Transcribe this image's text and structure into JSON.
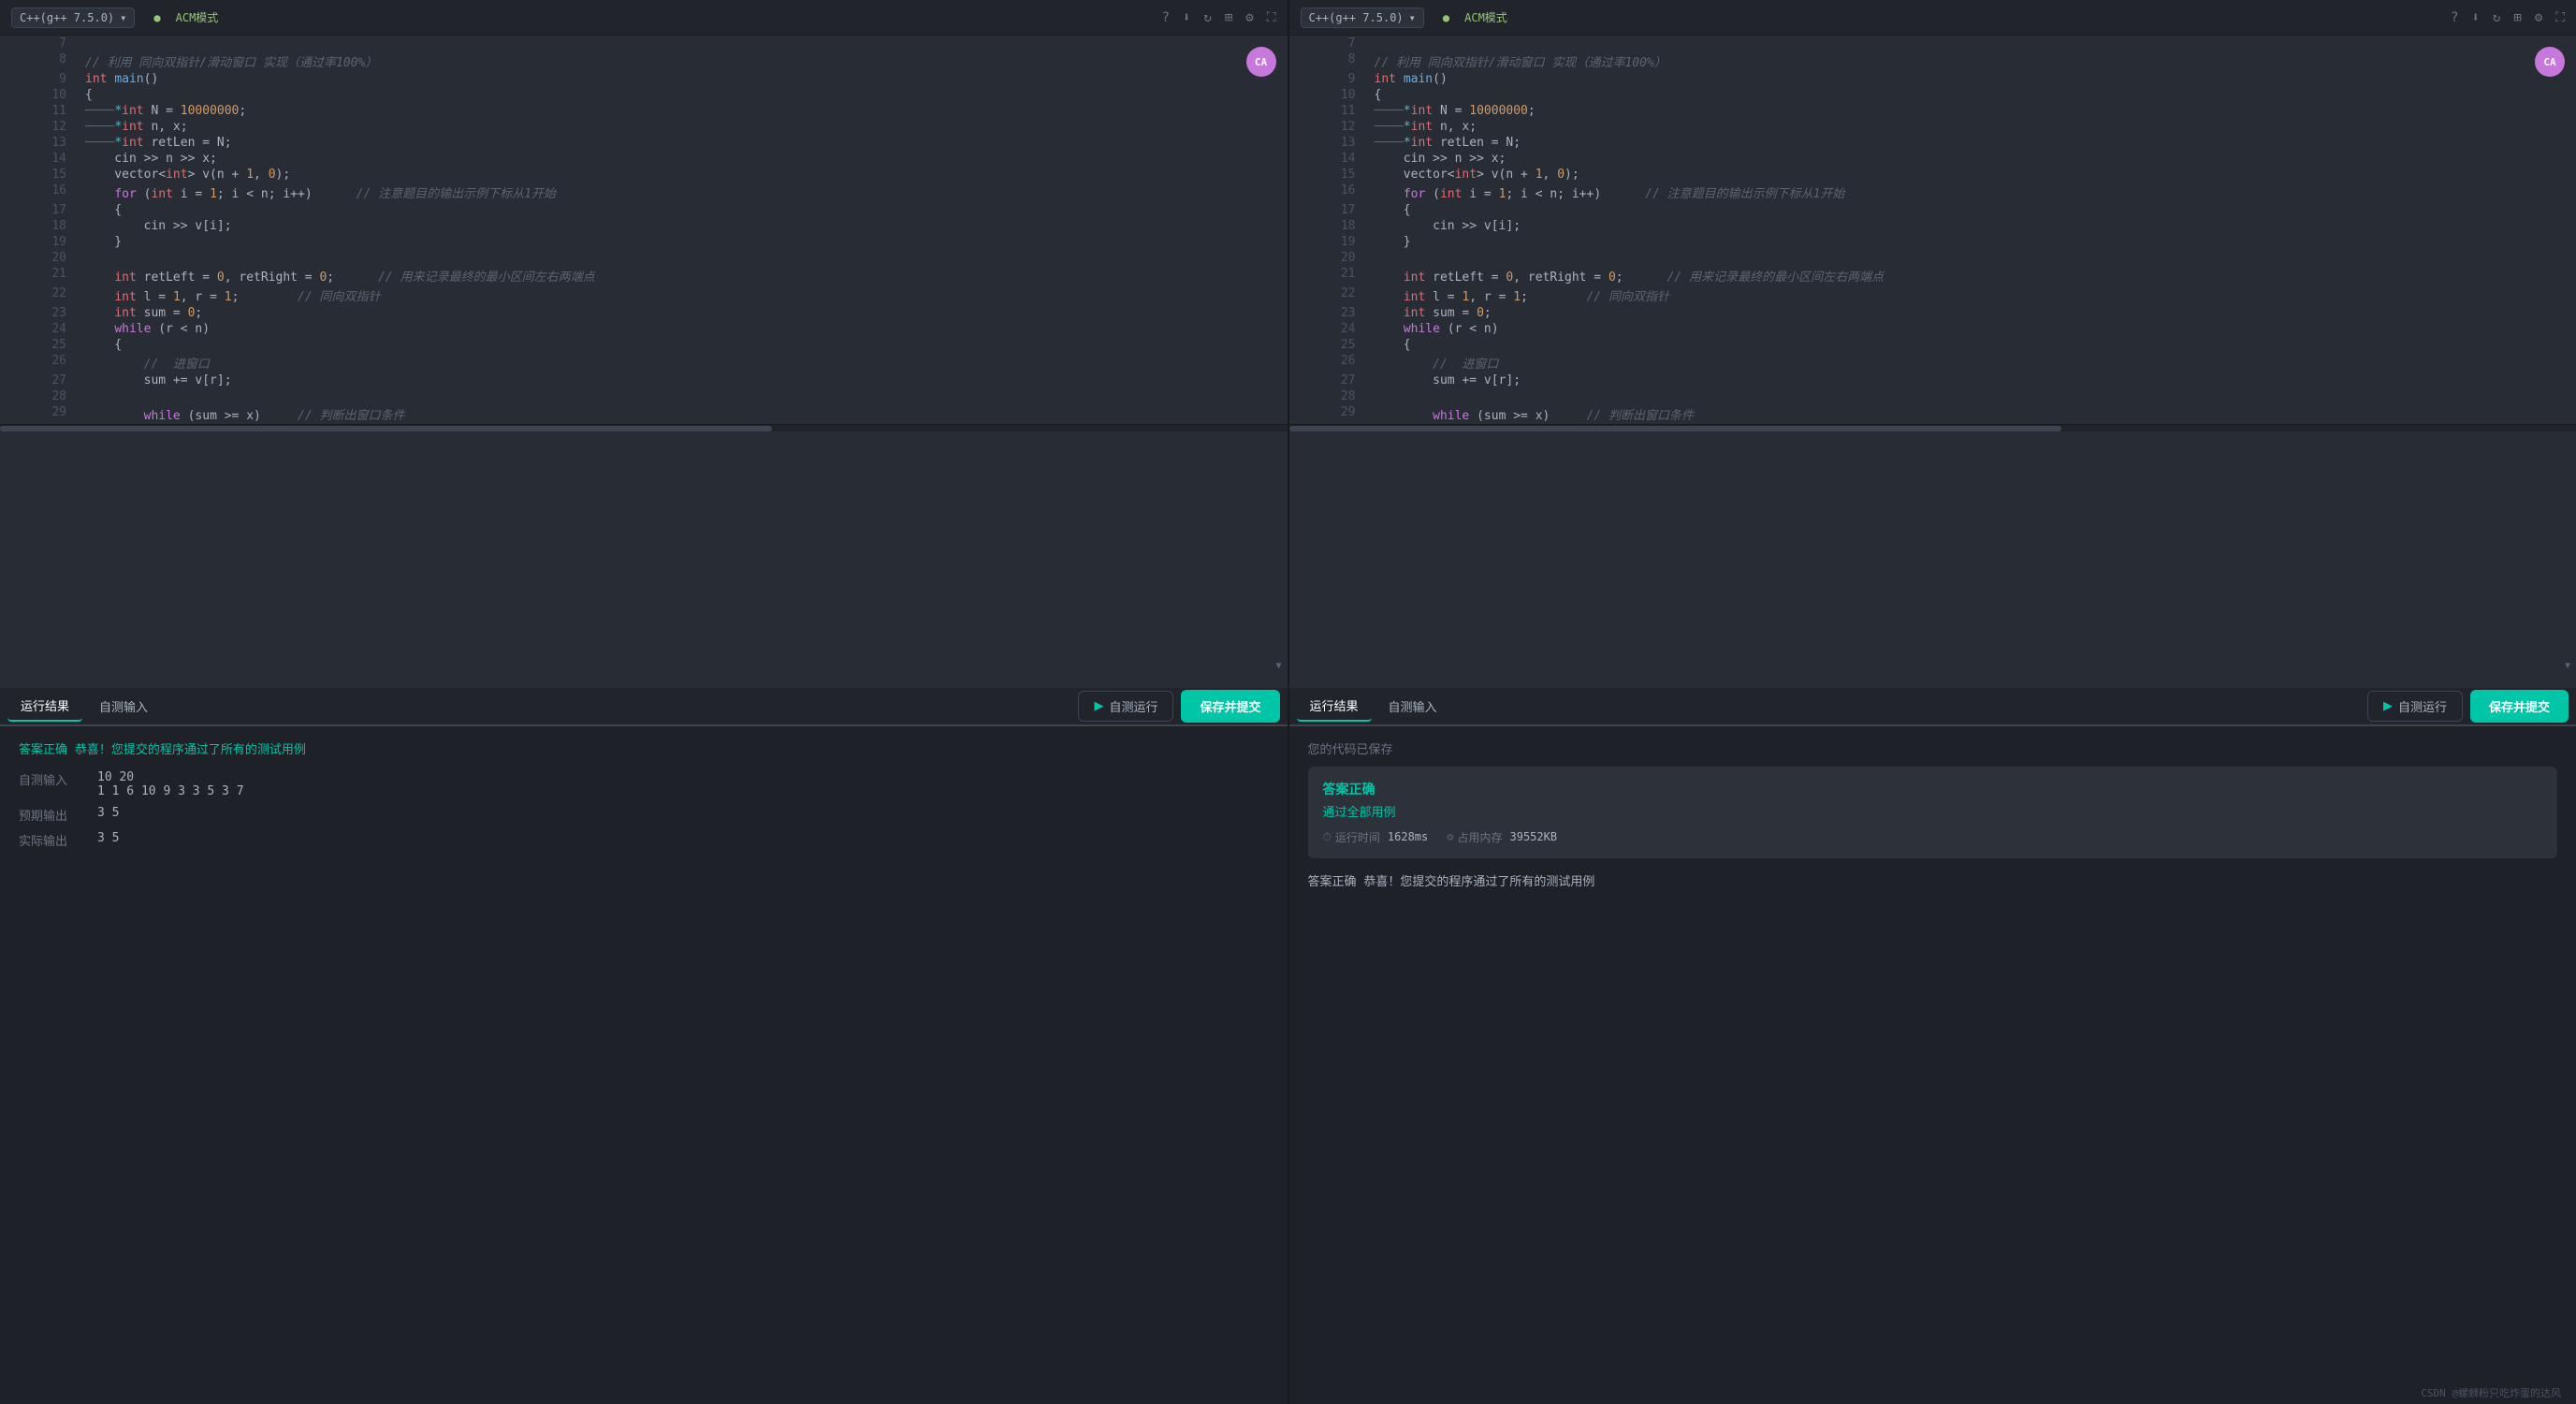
{
  "left_editor": {
    "top_bar": {
      "lang": "C++(g++ 7.5.0)",
      "mode": "ACM模式",
      "icons": [
        "?",
        "⬇",
        "↻",
        "⊞",
        "⚙",
        "⛶"
      ]
    },
    "lines": [
      {
        "num": 7,
        "code": ""
      },
      {
        "num": 8,
        "code": "// 利用 同向双指针/滑动窗口 实现（通过率100%）",
        "type": "comment"
      },
      {
        "num": 9,
        "code": "int main()",
        "type": "code"
      },
      {
        "num": 10,
        "code": "{",
        "type": "code"
      },
      {
        "num": 11,
        "code": "────*int N = 10000000;",
        "type": "code"
      },
      {
        "num": 12,
        "code": "────*int n, x;",
        "type": "code"
      },
      {
        "num": 13,
        "code": "────*int retLen = N;",
        "type": "code"
      },
      {
        "num": 14,
        "code": "    cin >> n >> x;",
        "type": "code"
      },
      {
        "num": 15,
        "code": "    vector<int> v(n + 1, 0);",
        "type": "code"
      },
      {
        "num": 16,
        "code": "    for (int i = 1; i < n; i++)      // 注意题目的输出示例下标从1开始",
        "type": "code"
      },
      {
        "num": 17,
        "code": "    {",
        "type": "code"
      },
      {
        "num": 18,
        "code": "        cin >> v[i];",
        "type": "code"
      },
      {
        "num": 19,
        "code": "    }",
        "type": "code"
      },
      {
        "num": 20,
        "code": "",
        "type": "code"
      },
      {
        "num": 21,
        "code": "    int retLeft = 0, retRight = 0;      // 用来记录最终的最小区间左右两端点",
        "type": "code"
      },
      {
        "num": 22,
        "code": "    int l = 1, r = 1;        // 同向双指针",
        "type": "code"
      },
      {
        "num": 23,
        "code": "    int sum = 0;",
        "type": "code"
      },
      {
        "num": 24,
        "code": "    while (r < n)",
        "type": "code"
      },
      {
        "num": 25,
        "code": "    {",
        "type": "code"
      },
      {
        "num": 26,
        "code": "        //  进窗口",
        "type": "comment"
      },
      {
        "num": 27,
        "code": "        sum += v[r];",
        "type": "code"
      },
      {
        "num": 28,
        "code": "",
        "type": "code"
      },
      {
        "num": 29,
        "code": "        while (sum >= x)     // 判断出窗口条件",
        "type": "code"
      }
    ],
    "bottom": {
      "tabs": [
        "运行结果",
        "自测输入"
      ],
      "active_tab": "运行结果",
      "test_run": "自测运行",
      "submit": "保存并提交"
    },
    "result": {
      "success_msg": "答案正确 恭喜！您提交的程序通过了所有的测试用例",
      "self_test_label": "自测输入",
      "self_test_value": "10 20\n1 1 6 10 9 3 3 5 3 7",
      "expected_label": "预期输出",
      "expected_value": "3 5",
      "actual_label": "实际输出",
      "actual_value": "3 5"
    }
  },
  "right_editor": {
    "top_bar": {
      "lang": "C++(g++ 7.5.0)",
      "mode": "ACM模式",
      "icons": [
        "?",
        "⬇",
        "↻",
        "⊞",
        "⚙",
        "⛶"
      ]
    },
    "lines": [
      {
        "num": 7,
        "code": ""
      },
      {
        "num": 8,
        "code": "// 利用 同向双指针/滑动窗口 实现（通过率100%）",
        "type": "comment"
      },
      {
        "num": 9,
        "code": "int main()",
        "type": "code"
      },
      {
        "num": 10,
        "code": "{",
        "type": "code"
      },
      {
        "num": 11,
        "code": "────*int N = 10000000;",
        "type": "code"
      },
      {
        "num": 12,
        "code": "────*int n, x;",
        "type": "code"
      },
      {
        "num": 13,
        "code": "────*int retLen = N;",
        "type": "code"
      },
      {
        "num": 14,
        "code": "    cin >> n >> x;",
        "type": "code"
      },
      {
        "num": 15,
        "code": "    vector<int> v(n + 1, 0);",
        "type": "code"
      },
      {
        "num": 16,
        "code": "    for (int i = 1; i < n; i++)      // 注意题目的输出示例下标从1开始",
        "type": "code"
      },
      {
        "num": 17,
        "code": "    {",
        "type": "code"
      },
      {
        "num": 18,
        "code": "        cin >> v[i];",
        "type": "code"
      },
      {
        "num": 19,
        "code": "    }",
        "type": "code"
      },
      {
        "num": 20,
        "code": "",
        "type": "code"
      },
      {
        "num": 21,
        "code": "    int retLeft = 0, retRight = 0;      // 用来记录最终的最小区间左右两端点",
        "type": "code"
      },
      {
        "num": 22,
        "code": "    int l = 1, r = 1;        // 同向双指针",
        "type": "code"
      },
      {
        "num": 23,
        "code": "    int sum = 0;",
        "type": "code"
      },
      {
        "num": 24,
        "code": "    while (r < n)",
        "type": "code"
      },
      {
        "num": 25,
        "code": "    {",
        "type": "code"
      },
      {
        "num": 26,
        "code": "        //  进窗口",
        "type": "comment"
      },
      {
        "num": 27,
        "code": "        sum += v[r];",
        "type": "code"
      },
      {
        "num": 28,
        "code": "",
        "type": "code"
      },
      {
        "num": 29,
        "code": "        while (sum >= x)     // 判断出窗口条件",
        "type": "code"
      }
    ],
    "bottom": {
      "tabs": [
        "运行结果",
        "自测输入"
      ],
      "active_tab": "运行结果",
      "test_run": "自测运行",
      "submit": "保存并提交"
    },
    "result": {
      "saved_msg": "您的代码已保存",
      "answer_correct": "答案正确",
      "pass_all": "通过全部用例",
      "run_time_label": "运行时间",
      "run_time_value": "1628ms",
      "memory_label": "占用内存",
      "memory_value": "39552KB",
      "success_msg": "答案正确 恭喜！您提交的程序通过了所有的测试用例"
    }
  },
  "translate_btn": "CA",
  "credit": "CSDN @螺蛳粉只吃炸蛋的达风"
}
